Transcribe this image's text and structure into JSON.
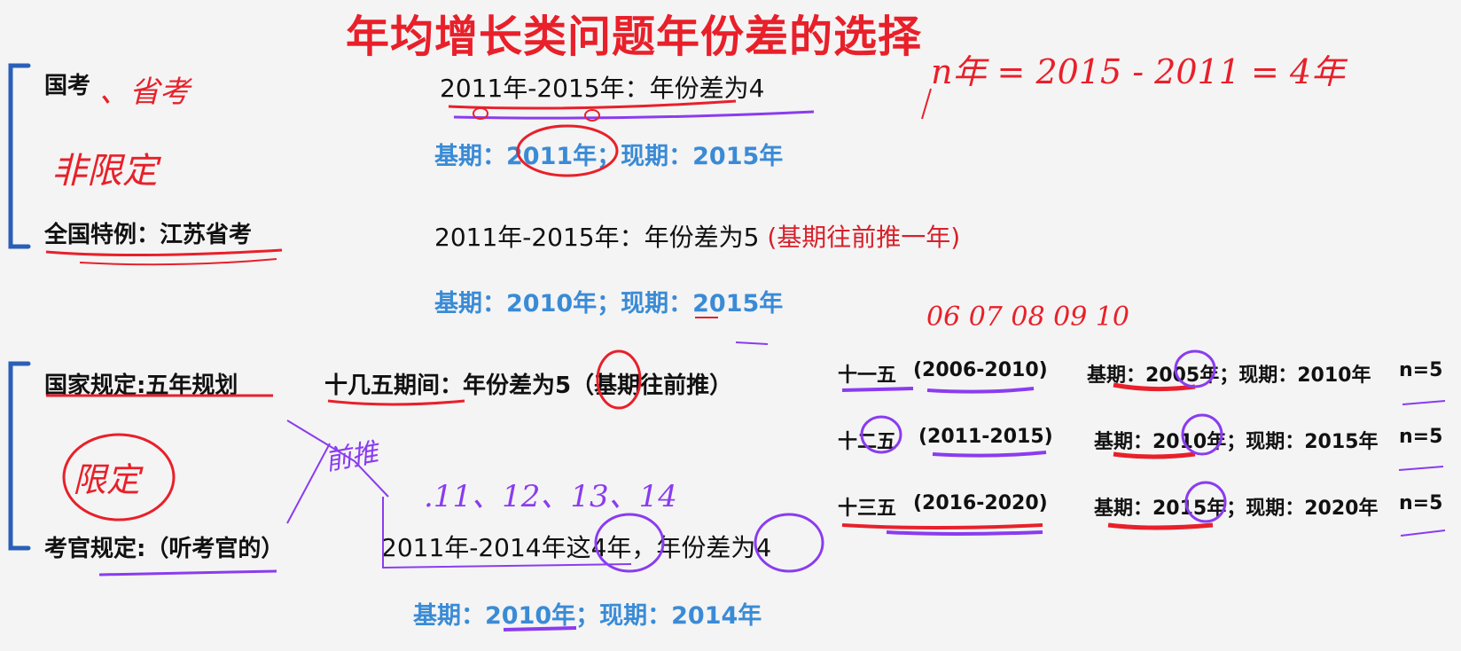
{
  "title": "年均增长类问题年份差的选择",
  "row1": {
    "label": "国考",
    "range": "2011年-2015年：年份差为4",
    "base_current": "基期：2011年；现期：2015年"
  },
  "row2": {
    "label_a": "全国特例：",
    "label_b": "江苏省考",
    "range": "2011年-2015年：年份差为5",
    "note": "(基期往前推一年)",
    "base_current": "基期：2010年；现期：2015年"
  },
  "row3": {
    "label": "国家规定:五年规划",
    "rule": "十几五期间：年份差为5（基期往前推）"
  },
  "plans": [
    {
      "name": "十一五",
      "years": "(2006-2010)",
      "info": "基期：2005年；现期：2010年",
      "n": "n=5"
    },
    {
      "name": "十二五",
      "years": "(2011-2015)",
      "info": "基期：2010年；现期：2015年",
      "n": "n=5"
    },
    {
      "name": "十三五",
      "years": "(2016-2020)",
      "info": "基期：2015年；现期：2020年",
      "n": "n=5"
    }
  ],
  "row4": {
    "label": "考官规定:（听考官的）",
    "range": "2011年-2014年这4年，年份差为4",
    "base_current": "基期：2010年；现期：2014年"
  },
  "handwriting": {
    "shengkao": "、省考",
    "feixianding": "非限定",
    "formula": "n年 = 2015 - 2011 = 4年",
    "years_seq": "06 07 08 09 10",
    "xianding": "限定",
    "qianyi": "前推",
    "nums": ".11、12、13、14"
  },
  "colors": {
    "title": "#e8202a",
    "blue": "#3a8bd6",
    "ink_red": "#e8202a",
    "ink_purple": "#8a3cf0",
    "bracket": "#2a5fb8"
  }
}
